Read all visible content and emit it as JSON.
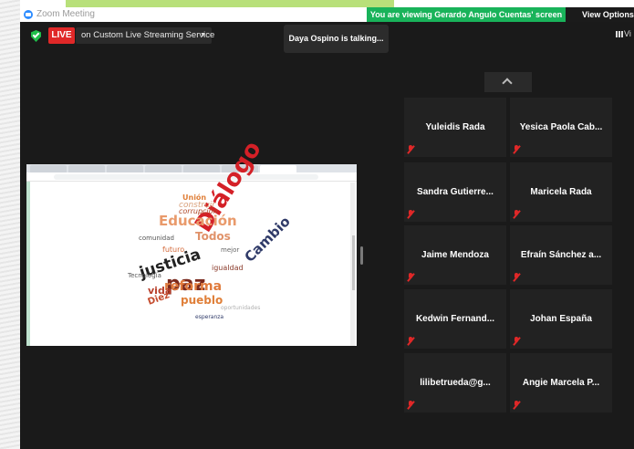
{
  "window": {
    "title": "Zoom Meeting"
  },
  "banner": {
    "text": "You are viewing Gerardo Angulo Cuentas' screen",
    "view_options": "View Options ˅"
  },
  "status": {
    "live": "LIVE",
    "stream": "on Custom Live Streaming Service",
    "talking": "Daya Ospino is talking...",
    "gallery": "Vi"
  },
  "participants": [
    {
      "name": "Yuleidis Rada"
    },
    {
      "name": "Yesica Paola Cab..."
    },
    {
      "name": "Sandra  Gutierre..."
    },
    {
      "name": "Maricela Rada"
    },
    {
      "name": "Jaime Mendoza"
    },
    {
      "name": "Efraín Sánchez a..."
    },
    {
      "name": "Kedwin  Fernand..."
    },
    {
      "name": "Johan España"
    },
    {
      "name": "lilibetrueda@g..."
    },
    {
      "name": "Angie  Marcela P..."
    }
  ],
  "shared_screen": {
    "words": [
      {
        "text": "Diálogo",
        "color": "#d42027"
      },
      {
        "text": "paz",
        "color": "#7a2a1e"
      },
      {
        "text": "justicia",
        "color": "#222222"
      },
      {
        "text": "Educación",
        "color": "#e99a6b"
      },
      {
        "text": "reforma",
        "color": "#e07a3c"
      },
      {
        "text": "Cambio",
        "color": "#2f3a68"
      },
      {
        "text": "vida",
        "color": "#b8402c"
      },
      {
        "text": "Todos",
        "color": "#e0926a"
      },
      {
        "text": "pueblo",
        "color": "#e0803a"
      },
      {
        "text": "Unión",
        "color": "#e0803a"
      },
      {
        "text": "construir",
        "color": "#d9a07a"
      },
      {
        "text": "corrupción",
        "color": "#b0492a"
      },
      {
        "text": "Tecnología",
        "color": "#555555"
      },
      {
        "text": "comunidad",
        "color": "#555555"
      },
      {
        "text": "Diez",
        "color": "#c44a2c"
      },
      {
        "text": "oportunidades",
        "color": "#b0b0b0"
      },
      {
        "text": "igualdad",
        "color": "#8a3a2a"
      },
      {
        "text": "futuro",
        "color": "#d46a3a"
      },
      {
        "text": "mejor",
        "color": "#666666"
      },
      {
        "text": "esperanza",
        "color": "#2f3a68"
      }
    ]
  }
}
